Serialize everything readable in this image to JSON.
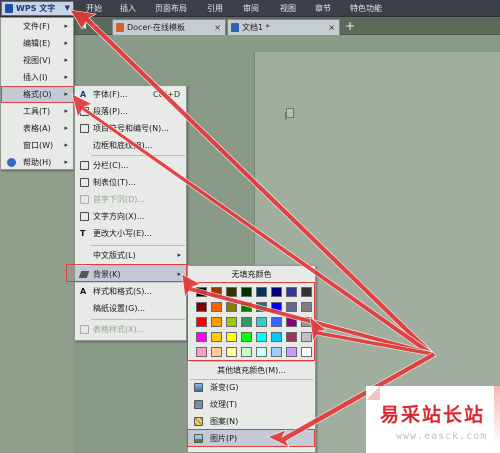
{
  "app_menu": {
    "label": "WPS 文字",
    "chevron": "▼"
  },
  "menubar": {
    "tabs": [
      "开始",
      "插入",
      "页面布局",
      "引用",
      "审阅",
      "视图",
      "章节",
      "特色功能"
    ]
  },
  "document_tabs": {
    "nav_prev": "◀",
    "nav_next": "▶",
    "tabs": [
      {
        "label": "Docer-在线模板",
        "close": "×"
      },
      {
        "label": "文档1 *",
        "close": "×"
      }
    ],
    "new_tab": "+"
  },
  "main_menu": {
    "items": [
      {
        "label": "文件(F)",
        "arrow": "▸"
      },
      {
        "label": "编辑(E)",
        "arrow": "▸"
      },
      {
        "label": "视图(V)",
        "arrow": "▸"
      },
      {
        "label": "插入(I)",
        "arrow": "▸"
      },
      {
        "label": "格式(O)",
        "arrow": "▸"
      },
      {
        "label": "工具(T)",
        "arrow": "▸"
      },
      {
        "label": "表格(A)",
        "arrow": "▸"
      },
      {
        "label": "窗口(W)",
        "arrow": "▸"
      },
      {
        "label": "帮助(H)",
        "arrow": "▸"
      }
    ]
  },
  "format_menu": {
    "items": [
      {
        "label": "字体(F)...",
        "shortcut": "Ctrl+D"
      },
      {
        "label": "段落(P)..."
      },
      {
        "label": "项目符号和编号(N)..."
      },
      {
        "label": "边框和底纹(B)..."
      },
      {
        "label": "分栏(C)..."
      },
      {
        "label": "制表位(T)..."
      },
      {
        "label": "首字下沉(D)..."
      },
      {
        "label": "文字方向(X)..."
      },
      {
        "label": "更改大小写(E)..."
      },
      {
        "label": "中文版式(L)",
        "arrow": "▸"
      },
      {
        "label": "背景(K)",
        "arrow": "▸"
      },
      {
        "label": "样式和格式(S)..."
      },
      {
        "label": "稿纸设置(G)..."
      },
      {
        "label": "表格样式(X)..."
      }
    ]
  },
  "background_menu": {
    "no_fill": "无填充颜色",
    "colors": [
      [
        "#000000",
        "#9a3a0a",
        "#333300",
        "#003300",
        "#003366",
        "#000080",
        "#333399",
        "#333333"
      ],
      [
        "#800000",
        "#ff6600",
        "#808000",
        "#008000",
        "#008080",
        "#0000ff",
        "#666699",
        "#808080"
      ],
      [
        "#ff0000",
        "#ff9900",
        "#99cc00",
        "#339966",
        "#33cccc",
        "#3366ff",
        "#800080",
        "#969696"
      ],
      [
        "#ff00ff",
        "#ffcc00",
        "#ffff00",
        "#00ff00",
        "#00ffff",
        "#00ccff",
        "#993366",
        "#c0c0c0"
      ],
      [
        "#ff99cc",
        "#ffcc99",
        "#ffff99",
        "#ccffcc",
        "#ccffff",
        "#99ccff",
        "#cc99ff",
        "#ffffff"
      ]
    ],
    "more_colors": "其他填充颜色(M)...",
    "items": [
      {
        "label": "渐变(G)"
      },
      {
        "label": "纹理(T)"
      },
      {
        "label": "图案(N)"
      },
      {
        "label": "图片(P)"
      }
    ]
  },
  "watermark": {
    "title": "易采站长站",
    "url": "www.easck.com"
  },
  "colors": {
    "highlight": "#dd4040",
    "arrow": "#e23a3a",
    "menu_bg": "#e7eae6",
    "selected": "#c3cad6"
  }
}
